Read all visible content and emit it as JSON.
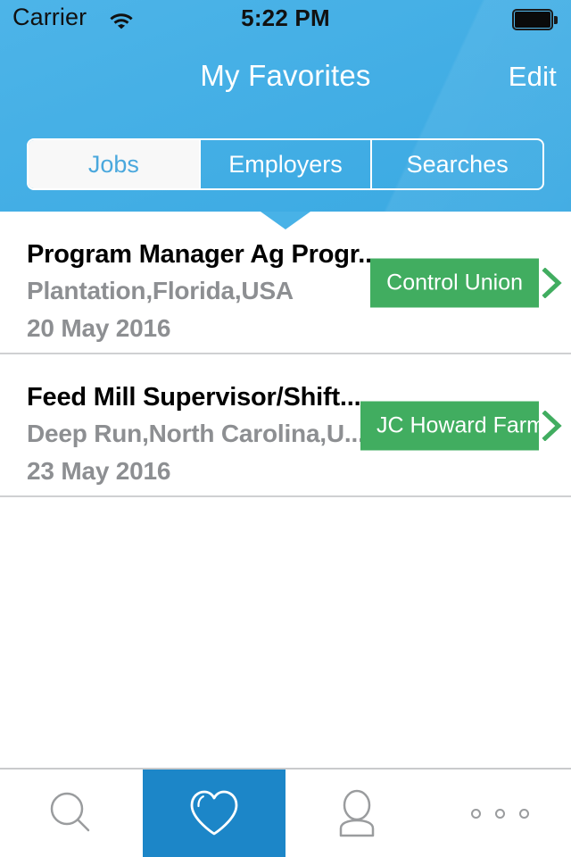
{
  "status_bar": {
    "carrier": "Carrier",
    "time": "5:22 PM",
    "wifi_icon": "wifi-icon",
    "battery_icon": "battery-full-icon"
  },
  "nav": {
    "title": "My Favorites",
    "edit_label": "Edit"
  },
  "segmented_control": {
    "selected": "Jobs",
    "segments": [
      {
        "label": "Jobs",
        "active": true
      },
      {
        "label": "Employers",
        "active": false
      },
      {
        "label": "Searches",
        "active": false
      }
    ]
  },
  "list": {
    "rows": [
      {
        "title": "Program Manager Ag Progr...",
        "location": "Plantation,Florida,USA",
        "date": "20 May 2016",
        "company": "Control Union",
        "chevron_icon": "chevron-right-icon"
      },
      {
        "title": "Feed Mill Supervisor/Shift...",
        "location": "Deep Run,North Carolina,U...",
        "date": "23 May 2016",
        "company": "JC Howard Farms",
        "chevron_icon": "chevron-right-icon"
      }
    ]
  },
  "tab_bar": {
    "tabs": [
      {
        "name": "search",
        "icon": "search-icon",
        "active": false
      },
      {
        "name": "favorites",
        "icon": "heart-icon",
        "active": true
      },
      {
        "name": "profile",
        "icon": "person-icon",
        "active": false
      },
      {
        "name": "more",
        "icon": "more-dots-icon",
        "active": false
      }
    ]
  },
  "colors": {
    "header_blue": "#48b2e7",
    "tab_active_blue": "#1c86c8",
    "badge_green": "#41ad60",
    "segment_active_text": "#4aa8dd",
    "secondary_text": "#8d8f92",
    "separator": "#cfd0d2"
  }
}
